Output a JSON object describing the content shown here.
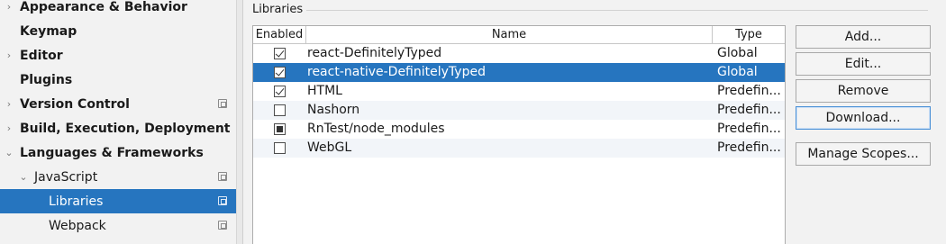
{
  "sidebar": {
    "items": [
      {
        "label": "Appearance & Behavior",
        "arrow": "›",
        "has_project_icon": false
      },
      {
        "label": "Keymap",
        "arrow": "",
        "has_project_icon": false
      },
      {
        "label": "Editor",
        "arrow": "›",
        "has_project_icon": false
      },
      {
        "label": "Plugins",
        "arrow": "",
        "has_project_icon": false
      },
      {
        "label": "Version Control",
        "arrow": "›",
        "has_project_icon": true
      },
      {
        "label": "Build, Execution, Deployment",
        "arrow": "›",
        "has_project_icon": false
      },
      {
        "label": "Languages & Frameworks",
        "arrow": "⌄",
        "has_project_icon": false
      },
      {
        "label": "JavaScript",
        "arrow": "⌄",
        "has_project_icon": true
      },
      {
        "label": "Libraries",
        "arrow": "",
        "has_project_icon": true,
        "selected": true
      },
      {
        "label": "Webpack",
        "arrow": "",
        "has_project_icon": true
      }
    ]
  },
  "libraries": {
    "group_title": "Libraries",
    "columns": {
      "enabled": "Enabled",
      "name": "Name",
      "type": "Type"
    },
    "rows": [
      {
        "checkbox": "checked",
        "name": "react-DefinitelyTyped",
        "type": "Global"
      },
      {
        "checkbox": "checked",
        "name": "react-native-DefinitelyTyped",
        "type": "Global",
        "selected": true
      },
      {
        "checkbox": "checked",
        "name": "HTML",
        "type": "Predefin..."
      },
      {
        "checkbox": "unchecked",
        "name": "Nashorn",
        "type": "Predefin..."
      },
      {
        "checkbox": "partial",
        "name": "RnTest/node_modules",
        "type": "Predefin..."
      },
      {
        "checkbox": "unchecked",
        "name": "WebGL",
        "type": "Predefin..."
      }
    ]
  },
  "buttons": {
    "add": "Add...",
    "edit": "Edit...",
    "remove": "Remove",
    "download": "Download...",
    "manage_scopes": "Manage Scopes..."
  },
  "colors": {
    "selection": "#2675bf",
    "panel_bg": "#f2f2f2"
  }
}
